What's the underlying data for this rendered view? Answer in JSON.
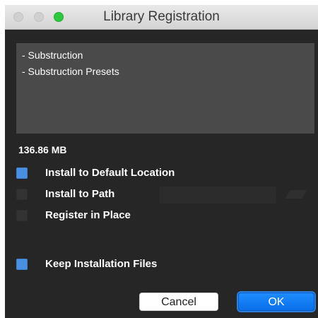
{
  "window": {
    "title": "Library Registration"
  },
  "package_list": [
    "- Substruction",
    "- Substruction Presets"
  ],
  "size_label": "136.86 MB",
  "options": {
    "install_default": {
      "label": "Install to Default Location",
      "checked": true
    },
    "install_to_path": {
      "label": "Install to Path",
      "checked": false,
      "path_value": ""
    },
    "register_in_place": {
      "label": "Register in Place",
      "checked": false
    },
    "keep_files": {
      "label": "Keep Installation Files",
      "checked": true
    }
  },
  "buttons": {
    "cancel": "Cancel",
    "ok": "OK"
  },
  "colors": {
    "accent": "#4a90e2",
    "ok_button": "#0a6fe8",
    "background": "#262626"
  }
}
